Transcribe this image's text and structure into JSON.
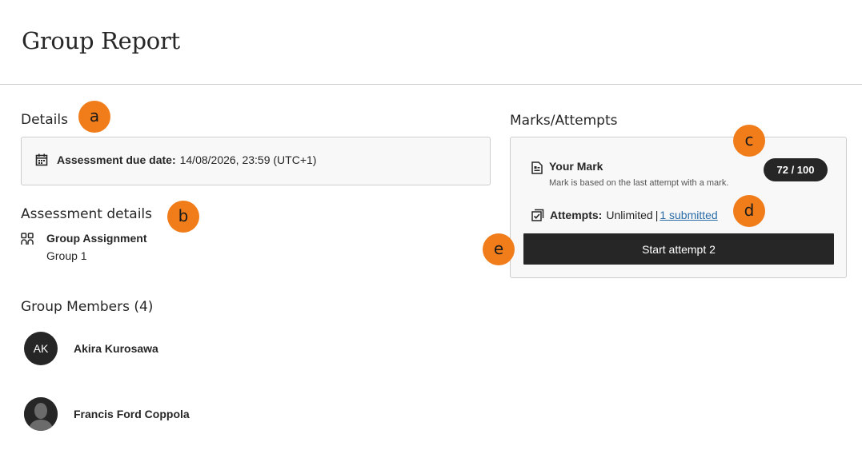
{
  "page": {
    "title": "Group Report"
  },
  "details": {
    "heading": "Details",
    "due_label": "Assessment due date:",
    "due_value": "14/08/2026, 23:59 (UTC+1)"
  },
  "assessment_details": {
    "heading": "Assessment details",
    "name": "Group Assignment",
    "group": "Group 1"
  },
  "group_members": {
    "heading": "Group Members (4)",
    "members": [
      {
        "initials": "AK",
        "name": "Akira Kurosawa",
        "avatar": "initials"
      },
      {
        "initials": "",
        "name": "Francis Ford Coppola",
        "avatar": "photo"
      }
    ]
  },
  "marks": {
    "heading": "Marks/Attempts",
    "your_mark_label": "Your Mark",
    "mark_note": "Mark is based on the last attempt with a mark.",
    "mark_value": "72 / 100",
    "attempts_label": "Attempts:",
    "attempts_value": "Unlimited",
    "attempts_separator": "|",
    "submitted_link": "1 submitted",
    "start_button": "Start attempt 2"
  },
  "callouts": {
    "a": "a",
    "b": "b",
    "c": "c",
    "d": "d",
    "e": "e"
  },
  "colors": {
    "callout": "#f07d1a",
    "dark": "#262626",
    "link": "#2a6ca8",
    "panel": "#f8f8f8",
    "border": "#cdcdcd"
  },
  "icons": {
    "due_date": "calendar-icon",
    "assessment": "group-assignment-icon",
    "mark": "document-mark-icon",
    "attempts": "attempts-checkbox-icon",
    "member_photo": "person-silhouette-icon"
  }
}
